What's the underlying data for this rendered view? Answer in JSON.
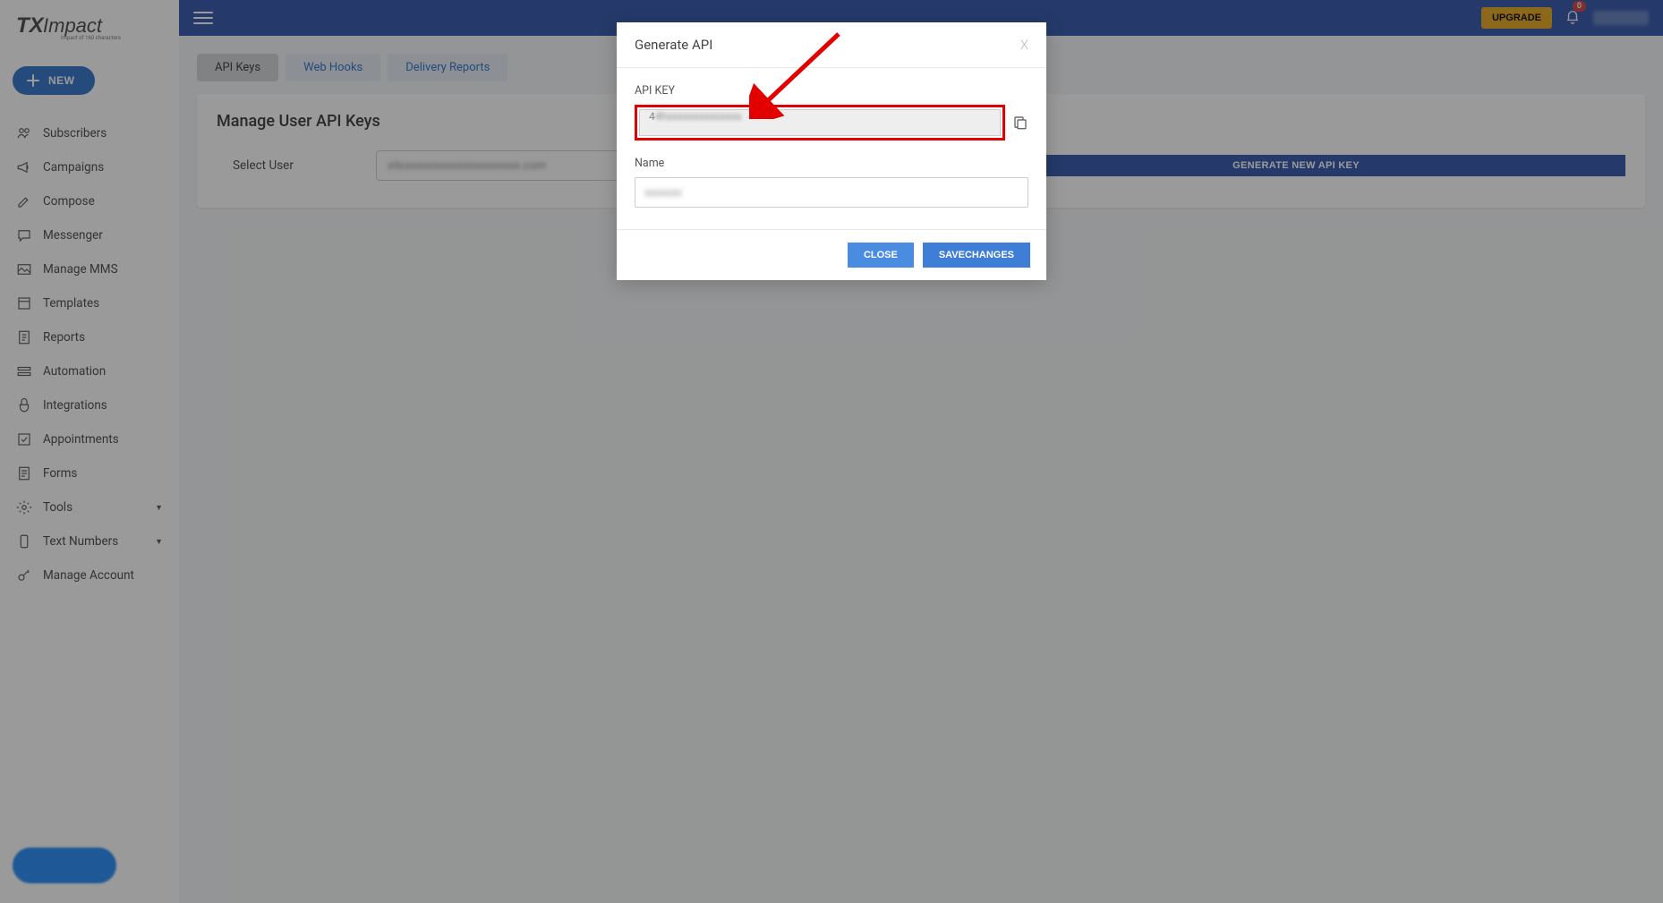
{
  "logo_text1": "TX",
  "logo_text2": "Impact",
  "logo_tagline": "Impact of 160 characters",
  "new_btn_label": "NEW",
  "nav": [
    {
      "label": "Subscribers"
    },
    {
      "label": "Campaigns"
    },
    {
      "label": "Compose"
    },
    {
      "label": "Messenger"
    },
    {
      "label": "Manage MMS"
    },
    {
      "label": "Templates"
    },
    {
      "label": "Reports"
    },
    {
      "label": "Automation"
    },
    {
      "label": "Integrations"
    },
    {
      "label": "Appointments"
    },
    {
      "label": "Forms"
    },
    {
      "label": "Tools",
      "expandable": true
    },
    {
      "label": "Text Numbers",
      "expandable": true
    },
    {
      "label": "Manage Account"
    }
  ],
  "topbar": {
    "upgrade_label": "UPGRADE",
    "badge_count": "0"
  },
  "tabs": [
    {
      "label": "API Keys",
      "active": true
    },
    {
      "label": "Web Hooks",
      "active": false
    },
    {
      "label": "Delivery Reports",
      "active": false
    }
  ],
  "page_title": "Manage User API Keys",
  "select_user_label": "Select User",
  "select_user_value": "xilxxxxxxxxxxxxxxxxxxxxx.com",
  "gen_btn_label": "GENERATE NEW API KEY",
  "modal": {
    "title": "Generate API",
    "close_x": "X",
    "api_key_label": "API KEY",
    "api_key_value": "4hxxxxxxxxxxxxxx",
    "name_label": "Name",
    "name_value": "xxxxxxx",
    "close_btn": "CLOSE",
    "save_btn": "SAVECHANGES"
  }
}
